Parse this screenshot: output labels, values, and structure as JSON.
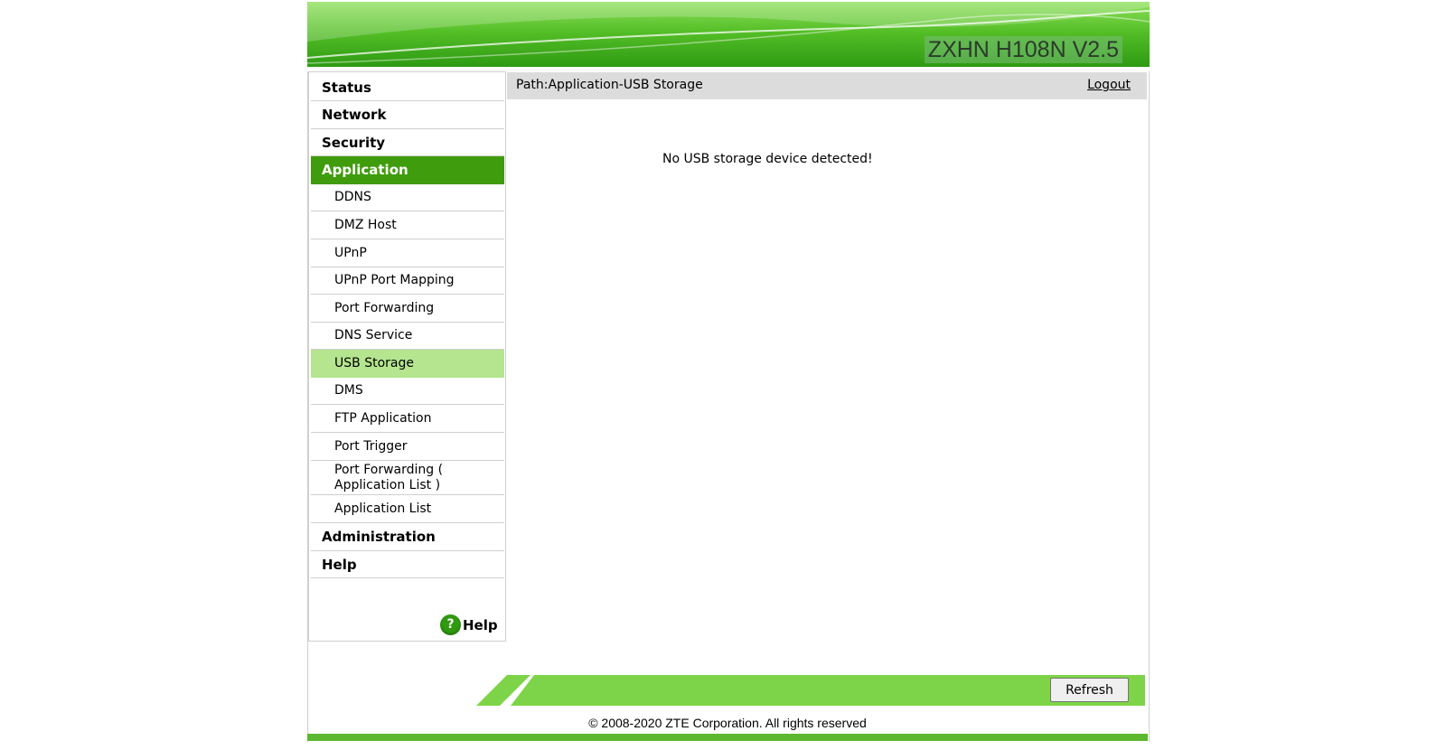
{
  "header": {
    "model": "ZXHN H108N V2.5"
  },
  "sidebar": {
    "items": [
      {
        "label": "Status"
      },
      {
        "label": "Network"
      },
      {
        "label": "Security"
      },
      {
        "label": "Application"
      },
      {
        "label": "DDNS"
      },
      {
        "label": "DMZ Host"
      },
      {
        "label": "UPnP"
      },
      {
        "label": "UPnP Port Mapping"
      },
      {
        "label": "Port Forwarding"
      },
      {
        "label": "DNS Service"
      },
      {
        "label": "USB Storage"
      },
      {
        "label": "DMS"
      },
      {
        "label": "FTP Application"
      },
      {
        "label": "Port Trigger"
      },
      {
        "label": "Port Forwarding ( Application List )"
      },
      {
        "label": "Application List"
      },
      {
        "label": "Administration"
      },
      {
        "label": "Help"
      }
    ],
    "help_link": "Help",
    "help_icon_glyph": "?"
  },
  "main": {
    "path": "Path:Application-USB Storage",
    "logout": "Logout",
    "message": "No USB storage device detected!"
  },
  "footer": {
    "refresh": "Refresh",
    "copyright": "© 2008-2020 ZTE Corporation. All rights reserved"
  },
  "colors": {
    "brand_green": "#3f9c0c",
    "active_sub": "#b5e58f",
    "footer_green": "#7ed448"
  }
}
